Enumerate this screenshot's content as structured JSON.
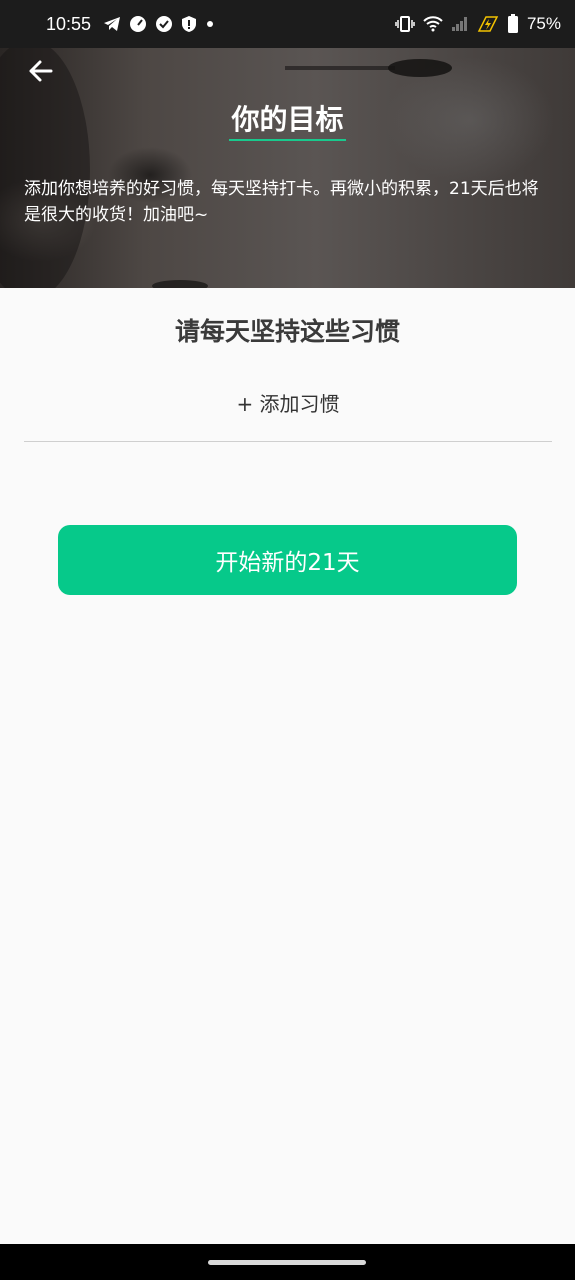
{
  "status_bar": {
    "time": "10:55",
    "battery_percent": "75%",
    "left_icons": [
      "telegram-icon",
      "speedometer-icon",
      "check-circle-icon",
      "shield-alert-icon",
      "dot-icon"
    ],
    "right_icons": [
      "vibrate-icon",
      "wifi-icon",
      "signal-icon",
      "charging-icon",
      "battery-icon"
    ]
  },
  "header": {
    "title": "你的目标",
    "description": "添加你想培养的好习惯，每天坚持打卡。再微小的积累，21天后也将是很大的收货！加油吧~"
  },
  "content": {
    "section_title": "请每天坚持这些习惯",
    "add_habit_label": "+ 添加习惯",
    "start_button_label": "开始新的21天"
  },
  "colors": {
    "accent": "#06c98a",
    "title_underline": "#19c98d",
    "background": "#fafafa"
  }
}
